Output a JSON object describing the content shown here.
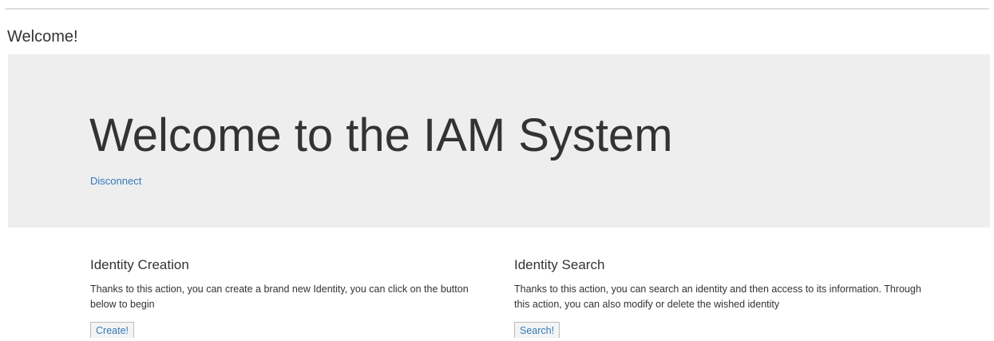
{
  "page": {
    "heading": "Welcome!"
  },
  "hero": {
    "title": "Welcome to the IAM System",
    "disconnect_label": "Disconnect"
  },
  "cards": [
    {
      "title": "Identity Creation",
      "description": "Thanks to this action, you can create a brand new Identity, you can click on the button below to begin",
      "button_label": "Create!"
    },
    {
      "title": "Identity Search",
      "description": "Thanks to this action, you can search an identity and then access to its information. Through this action, you can also modify or delete the wished identity",
      "button_label": "Search!"
    }
  ],
  "colors": {
    "hero_background": "#eeeeee",
    "link": "#337ab7",
    "text": "#333333"
  }
}
